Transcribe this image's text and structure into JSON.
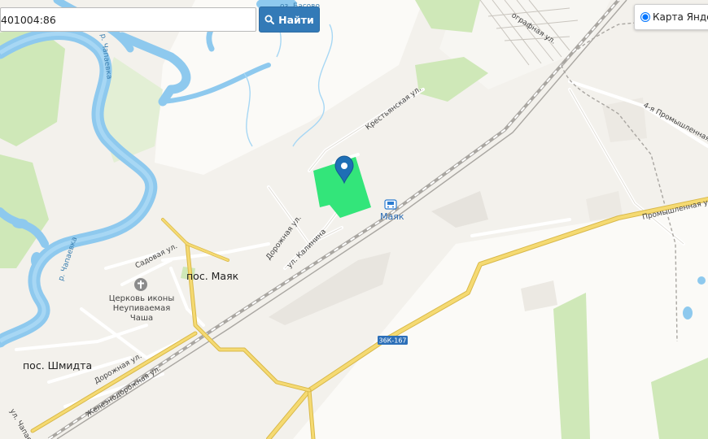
{
  "search": {
    "value": "401004:86",
    "button_label": "Найти"
  },
  "layer": {
    "label": "Карта Янде"
  },
  "map": {
    "settlements": {
      "mayak": "пос. Маяк",
      "shmidta": "пос. Шмидта"
    },
    "station": "Маяк",
    "church": [
      "Церковь иконы",
      "Неупиваемая",
      "Чаша"
    ],
    "streets": {
      "krestyanskaya": "Крестьянская ул.",
      "dorozhnaya": "Дорожная ул.",
      "kalinina": "ул. Калинина",
      "sadovaya": "Садовая ул.",
      "dorozhnaya2": "Дорожная ул.",
      "zheleznodorozhnaya": "Железнодорожная ул.",
      "promyshlennaya4": "4-я Промышленная ул.",
      "promyshlennaya": "Промышленная ул.",
      "ogradnaya": "ографная ул."
    },
    "water": {
      "lake": "оз. Басово",
      "river1": "р. Чапаевка",
      "river2": "р. Чапаевка",
      "river3": "ул. Чапае"
    },
    "road_shield": "36К-167",
    "colors": {
      "background": "#f3f1ec",
      "water": "#8ec9ee",
      "park": "#cfe8b8",
      "road": "#f3d46a",
      "parcel": "#33e57a",
      "marker": "#1e6fb5"
    }
  }
}
